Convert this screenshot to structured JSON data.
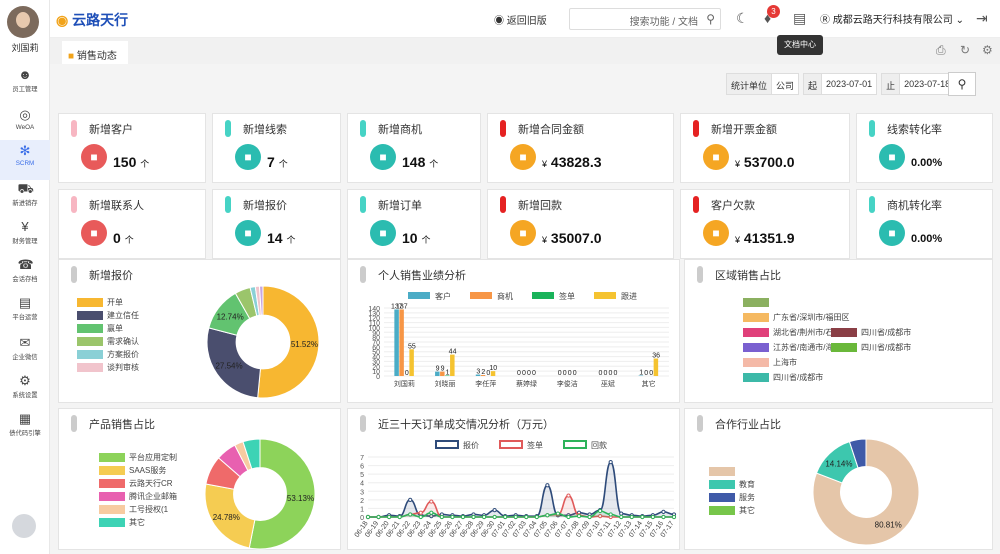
{
  "user": {
    "name": "刘国莉"
  },
  "sidebar": {
    "items": [
      {
        "label": "员工管理",
        "icon": "person-icon"
      },
      {
        "label": "WeOA",
        "icon": "settings-circle-icon"
      },
      {
        "label": "SCRM",
        "icon": "network-icon"
      },
      {
        "label": "新进销存",
        "icon": "truck-icon"
      },
      {
        "label": "财务管理",
        "icon": "money-icon"
      },
      {
        "label": "会话存档",
        "icon": "headset-icon"
      },
      {
        "label": "平台运营",
        "icon": "building-icon"
      },
      {
        "label": "企业微信",
        "icon": "chat-icon"
      },
      {
        "label": "系统设置",
        "icon": "gear-icon"
      },
      {
        "label": "债代码引擎",
        "icon": "code-icon"
      }
    ]
  },
  "header": {
    "logo": "云路天行",
    "back_old": "返回旧版",
    "search_placeholder": "搜索功能 / 文档",
    "notif_count": "3",
    "company": "成都云路天行科技有限公司",
    "tooltip": "文档中心"
  },
  "tab": {
    "label": "销售动态"
  },
  "filter": {
    "unit_label": "统计单位",
    "unit_value": "公司",
    "start_label": "起",
    "start_date": "2023-07-01",
    "end_label": "止",
    "end_date": "2023-07-18"
  },
  "stats": [
    {
      "title": "新增客户",
      "value": "150",
      "unit": "个",
      "color": "#f7b6c2",
      "icon_color": "#e85a5a",
      "icon": "user-icon"
    },
    {
      "title": "新增线索",
      "value": "7",
      "unit": "个",
      "color": "#46d3c5",
      "icon_color": "#2bbcb0",
      "icon": "lead-icon"
    },
    {
      "title": "新增商机",
      "value": "148",
      "unit": "个",
      "color": "#46d3c5",
      "icon_color": "#2bbcb0",
      "icon": "opportunity-icon"
    },
    {
      "title": "新增合同金额",
      "value": "43828.3",
      "unit": "¥",
      "color": "#e52222",
      "icon_color": "#f5a623",
      "icon": "contract-icon"
    },
    {
      "title": "新增开票金额",
      "value": "53700.0",
      "unit": "¥",
      "color": "#e52222",
      "icon_color": "#f5a623",
      "icon": "invoice-icon"
    },
    {
      "title": "线索转化率",
      "value": "0.00%",
      "unit": "",
      "color": "#46d3c5",
      "icon_color": "#2bbcb0",
      "icon": "chart-up-icon"
    },
    {
      "title": "新增联系人",
      "value": "0",
      "unit": "个",
      "color": "#f7b6c2",
      "icon_color": "#e85a5a",
      "icon": "contacts-icon"
    },
    {
      "title": "新增报价",
      "value": "14",
      "unit": "个",
      "color": "#46d3c5",
      "icon_color": "#2bbcb0",
      "icon": "quote-icon"
    },
    {
      "title": "新增订单",
      "value": "10",
      "unit": "个",
      "color": "#46d3c5",
      "icon_color": "#2bbcb0",
      "icon": "cart-icon"
    },
    {
      "title": "新增回款",
      "value": "35007.0",
      "unit": "¥",
      "color": "#e52222",
      "icon_color": "#f5a623",
      "icon": "tag-icon"
    },
    {
      "title": "客户欠款",
      "value": "41351.9",
      "unit": "¥",
      "color": "#e52222",
      "icon_color": "#f5a623",
      "icon": "box-icon"
    },
    {
      "title": "商机转化率",
      "value": "0.00%",
      "unit": "",
      "color": "#46d3c5",
      "icon_color": "#2bbcb0",
      "icon": "card-icon"
    }
  ],
  "panels": {
    "quote": "新增报价",
    "personal": "个人销售业绩分析",
    "region": "区域销售占比",
    "product": "产品销售占比",
    "trend": "近三十天订单成交情况分析（万元）",
    "industry": "合作行业占比"
  },
  "chart_data": [
    {
      "type": "pie",
      "title": "新增报价",
      "labels": [
        "开单",
        "建立信任",
        "赢单",
        "需求确认",
        "方案报价",
        "谈判审核",
        ""
      ],
      "values": [
        51.52,
        27.54,
        12.74,
        4.5,
        1.5,
        1.2,
        1.0
      ],
      "colors": [
        "#f7b731",
        "#4a4e6e",
        "#62c370",
        "#9bc56b",
        "#8ad0d6",
        "#f1c4cc",
        "#c8a7e0"
      ],
      "data_labels": [
        "51.52%",
        "27.54%",
        "12.74%",
        "",
        "",
        "",
        ""
      ]
    },
    {
      "type": "bar",
      "title": "个人销售业绩分析",
      "categories": [
        "刘国莉",
        "刘晓丽",
        "李任萍",
        "蔡婷绿",
        "李俊洁",
        "巫斌",
        "其它"
      ],
      "series": [
        {
          "name": "客户",
          "color": "#4bacc6",
          "values": [
            137,
            9,
            3,
            0,
            0,
            0,
            1
          ]
        },
        {
          "name": "商机",
          "color": "#f79646",
          "values": [
            137,
            9,
            2,
            0,
            0,
            0,
            0
          ]
        },
        {
          "name": "签单",
          "color": "#19b35a",
          "values": [
            0,
            1,
            0,
            0,
            0,
            0,
            0
          ]
        },
        {
          "name": "跟进",
          "color": "#f5c330",
          "values": [
            55,
            44,
            10,
            0,
            0,
            0,
            36
          ]
        }
      ],
      "ylim": [
        0,
        140
      ],
      "yticks": [
        0,
        10,
        20,
        30,
        40,
        50,
        60,
        70,
        80,
        90,
        100,
        110,
        120,
        130,
        140
      ]
    },
    {
      "type": "pie",
      "title": "区域销售占比",
      "legend": [
        {
          "label": "",
          "color": "#8bb060"
        },
        {
          "label": "广东省/深圳市/福田区",
          "color": "#f5b961"
        },
        {
          "label": "湖北省/荆州市/石首市",
          "color": "#e0407a"
        },
        {
          "label": "四川省/成都市",
          "color": "#8a3e45"
        },
        {
          "label": "江苏省/南通市/海安市",
          "color": "#7a60d0"
        },
        {
          "label": "四川省/成都市",
          "color": "#6ab83a"
        },
        {
          "label": "上海市",
          "color": "#f4b9a7"
        },
        {
          "label": "四川省/成都市",
          "color": "#3cb9a8"
        }
      ]
    },
    {
      "type": "pie",
      "title": "产品销售占比",
      "labels": [
        "平台应用定制",
        "SAAS服务",
        "云路天行CR",
        "腾讯企业邮箱",
        "工号授权(1",
        "其它"
      ],
      "values": [
        53.13,
        24.78,
        8.5,
        6.0,
        2.59,
        5.0
      ],
      "colors": [
        "#8dd35a",
        "#f5cc52",
        "#ef6a6a",
        "#e860b0",
        "#f7cba1",
        "#3dd3b5"
      ],
      "data_labels": [
        "53.13%",
        "24.78%",
        "",
        "",
        "",
        ""
      ]
    },
    {
      "type": "line",
      "title": "近三十天订单成交情况分析（万元）",
      "x": [
        "06-18",
        "06-19",
        "06-20",
        "06-21",
        "06-22",
        "06-23",
        "06-24",
        "06-25",
        "06-26",
        "06-27",
        "06-28",
        "06-29",
        "06-30",
        "07-01",
        "07-02",
        "07-03",
        "07-04",
        "07-05",
        "07-06",
        "07-07",
        "07-08",
        "07-09",
        "07-10",
        "07-11",
        "07-12",
        "07-13",
        "07-14",
        "07-15",
        "07-16",
        "07-17"
      ],
      "series": [
        {
          "name": "报价",
          "color": "#2e4b7a",
          "values": [
            0,
            0,
            0.2,
            0.1,
            2,
            0.2,
            0.1,
            0.3,
            0.2,
            0.1,
            0.3,
            0.2,
            0.8,
            0.1,
            0.2,
            0.1,
            0.1,
            3.7,
            0.2,
            0.2,
            0.5,
            0.3,
            0.8,
            6.4,
            0.4,
            0.2,
            0.1,
            0.2,
            0.6,
            0.3
          ]
        },
        {
          "name": "签单",
          "color": "#e05a5a",
          "values": [
            0,
            0,
            0,
            0,
            0.3,
            0.5,
            1.8,
            0,
            0,
            0,
            0,
            0,
            0,
            0,
            0,
            0,
            0,
            0.2,
            0.3,
            2.5,
            0.2,
            0,
            0.1,
            0,
            0,
            0,
            0,
            0,
            0,
            0
          ]
        },
        {
          "name": "回款",
          "color": "#2db35a",
          "values": [
            0,
            0,
            0,
            0,
            0.3,
            0,
            0.5,
            0,
            0,
            0,
            0,
            0,
            0,
            0,
            0,
            0,
            0,
            0.2,
            0.4,
            0,
            0.1,
            0,
            0.7,
            0.3,
            0,
            0,
            0,
            0,
            0,
            0
          ]
        }
      ],
      "ylim": [
        0,
        7
      ],
      "yticks": [
        0,
        1,
        2,
        3,
        4,
        5,
        6,
        7
      ]
    },
    {
      "type": "pie",
      "title": "合作行业占比",
      "labels": [
        "",
        "教育",
        "服务",
        "其它"
      ],
      "values": [
        80.81,
        14.14,
        5.05,
        0
      ],
      "colors": [
        "#e5c6a9",
        "#3dc7ae",
        "#3f5aa8",
        "#77c64a"
      ],
      "data_labels": [
        "80.81%",
        "14.14%",
        "",
        ""
      ]
    }
  ]
}
